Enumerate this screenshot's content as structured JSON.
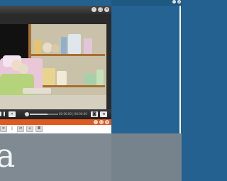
{
  "desktop": {
    "bottom_letter": "a",
    "accent_blue": "#256393",
    "gray": "#76838d"
  },
  "player": {
    "title_buttons": [
      "minimize-icon",
      "maximize-icon",
      "close-icon"
    ],
    "controls": {
      "pause_icon": "pause-icon",
      "next_icon": "fast-forward-icon",
      "volume_icon": "volume-icon",
      "progress": 0.62,
      "time": "00:00:00 | 00:00:00",
      "snapshot_icon": "camera-icon",
      "speaker_icon": "speaker-icon"
    }
  },
  "secondary_window": {
    "title_color": "#e05a1f",
    "buttons": [
      "minimize-icon",
      "maximize-icon",
      "close-icon"
    ],
    "toolbar_icons": [
      "list-icon",
      "folder-icon",
      "share-icon",
      "tag-icon",
      "camera-icon"
    ]
  }
}
